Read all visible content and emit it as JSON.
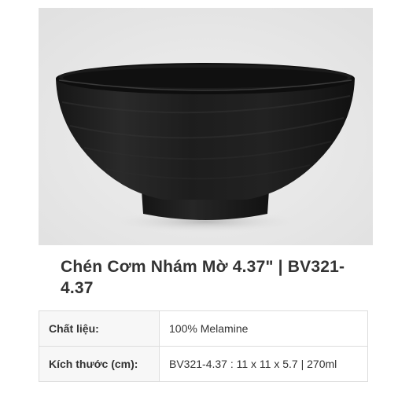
{
  "product": {
    "image_alt": "black matte melamine rice bowl",
    "title": "Chén Cơm Nhám Mờ 4.37\" | BV321-4.37"
  },
  "specs": [
    {
      "label": "Chất liệu:",
      "value": "100% Melamine"
    },
    {
      "label": "Kích thước (cm):",
      "value": "BV321-4.37 : 11 x 11 x 5.7 | 270ml"
    }
  ]
}
